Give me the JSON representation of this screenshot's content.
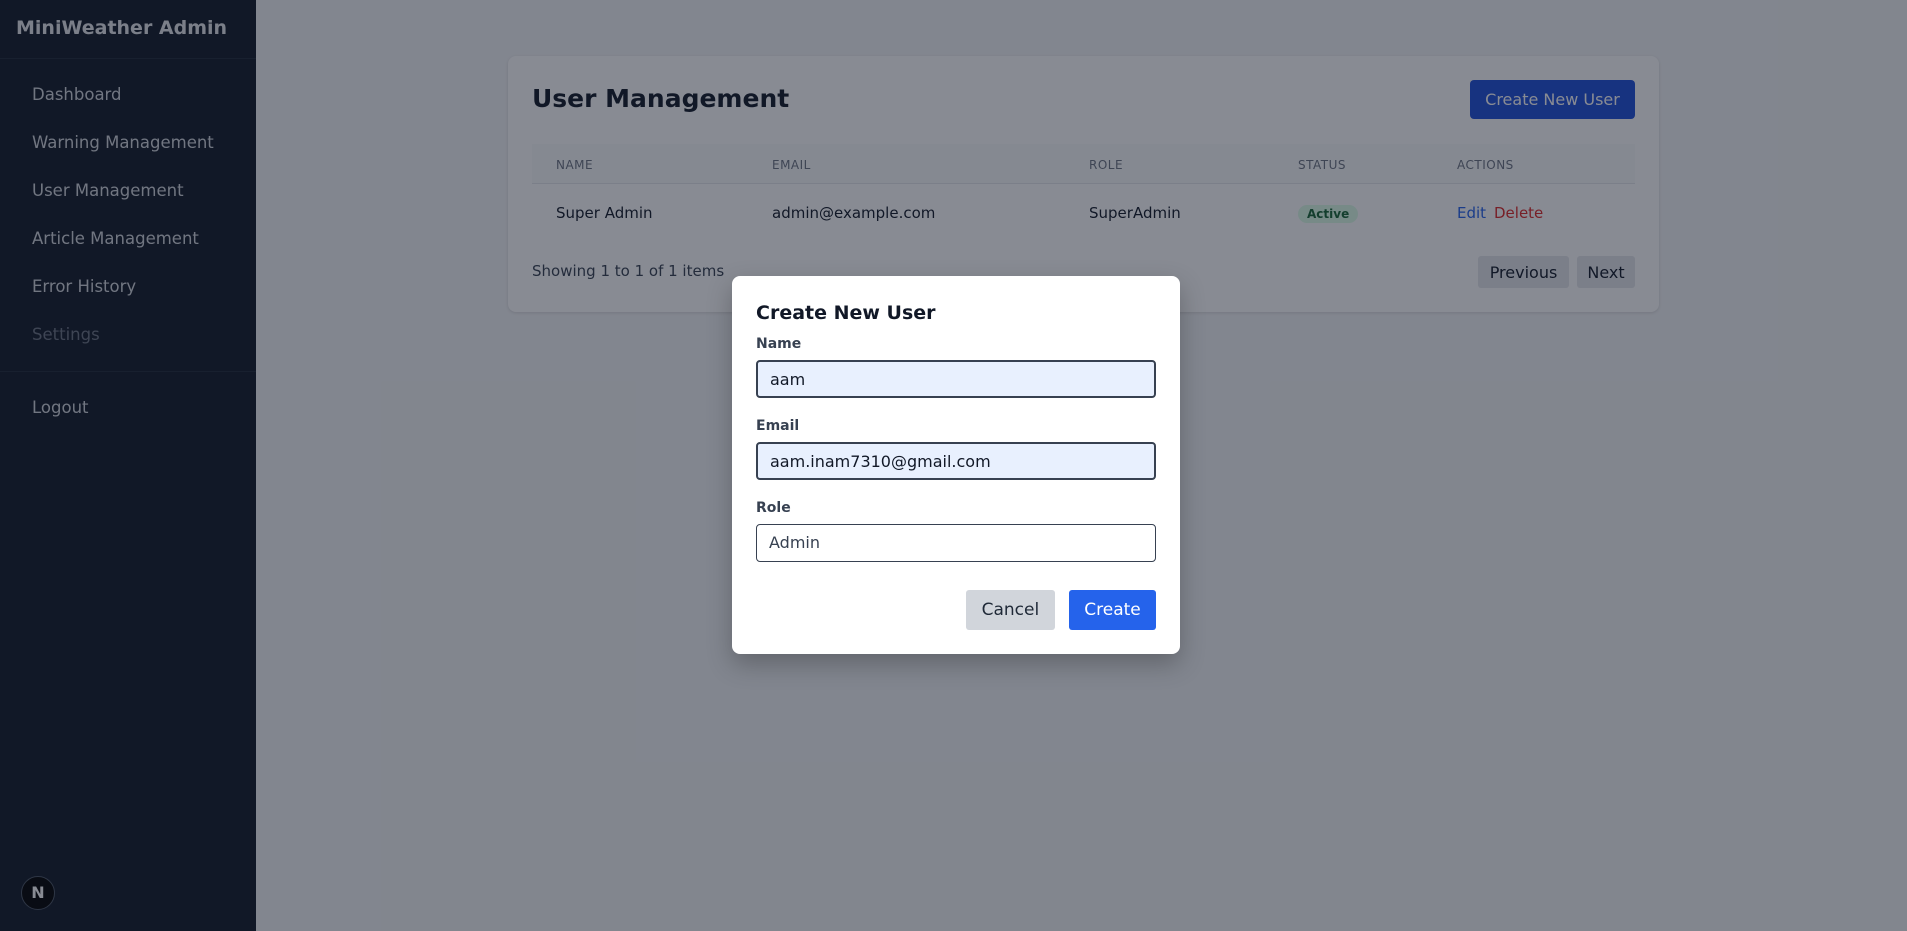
{
  "app": {
    "title": "MiniWeather Admin"
  },
  "sidebar": {
    "items": [
      {
        "label": "Dashboard"
      },
      {
        "label": "Warning Management"
      },
      {
        "label": "User Management"
      },
      {
        "label": "Article Management"
      },
      {
        "label": "Error History"
      },
      {
        "label": "Settings"
      }
    ],
    "logout": "Logout",
    "badge": "N"
  },
  "main": {
    "title": "User Management",
    "create_button": "Create New User",
    "table": {
      "headers": [
        "NAME",
        "EMAIL",
        "ROLE",
        "STATUS",
        "ACTIONS"
      ],
      "rows": [
        {
          "name": "Super Admin",
          "email": "admin@example.com",
          "role": "SuperAdmin",
          "status": "Active",
          "edit": "Edit",
          "delete": "Delete"
        }
      ]
    },
    "pagination": {
      "summary": "Showing 1 to 1 of 1 items",
      "previous": "Previous",
      "next": "Next"
    }
  },
  "modal": {
    "title": "Create New User",
    "name_label": "Name",
    "name_value": "aam",
    "email_label": "Email",
    "email_value": "aam.inam7310@gmail.com",
    "role_label": "Role",
    "role_value": "Admin",
    "cancel": "Cancel",
    "create": "Create"
  },
  "colors": {
    "accent": "#2563eb",
    "sidebar_bg": "#111827",
    "danger": "#dc2626",
    "status_active": "#166534"
  }
}
